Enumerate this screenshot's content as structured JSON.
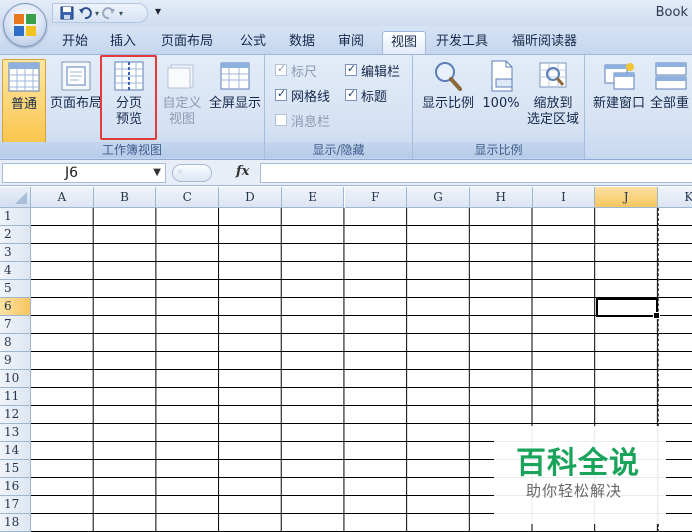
{
  "window": {
    "title": "Book"
  },
  "qat": {
    "more_glyph": "▾"
  },
  "tabs": [
    {
      "label": "开始",
      "active": false
    },
    {
      "label": "插入",
      "active": false
    },
    {
      "label": "页面布局",
      "active": false
    },
    {
      "label": "公式",
      "active": false
    },
    {
      "label": "数据",
      "active": false
    },
    {
      "label": "审阅",
      "active": false
    },
    {
      "label": "视图",
      "active": true
    },
    {
      "label": "开发工具",
      "active": false
    },
    {
      "label": "福昕阅读器",
      "active": false
    }
  ],
  "ribbon": {
    "workbook_views": {
      "group_label": "工作簿视图",
      "normal": "普通",
      "page_layout": "页面布局",
      "page_break_line1": "分页",
      "page_break_line2": "预览",
      "custom_line1": "自定义",
      "custom_line2": "视图",
      "fullscreen": "全屏显示"
    },
    "show_hide": {
      "group_label": "显示/隐藏",
      "ruler": {
        "label": "标尺",
        "checked": true,
        "disabled": true
      },
      "formula_bar": {
        "label": "编辑栏",
        "checked": true,
        "disabled": false
      },
      "gridlines": {
        "label": "网格线",
        "checked": true,
        "disabled": false
      },
      "headings": {
        "label": "标题",
        "checked": true,
        "disabled": false
      },
      "message_bar": {
        "label": "消息栏",
        "checked": false,
        "disabled": true
      }
    },
    "zoom": {
      "group_label": "显示比例",
      "zoom": "显示比例",
      "zoom100": "100%",
      "zoom_sel_line1": "缩放到",
      "zoom_sel_line2": "选定区域"
    },
    "window": {
      "new_window": "新建窗口",
      "arrange_all": "全部重"
    }
  },
  "formula_bar": {
    "name_box": "J6",
    "fx": "fx",
    "formula": ""
  },
  "grid": {
    "columns": [
      "A",
      "B",
      "C",
      "D",
      "E",
      "F",
      "G",
      "H",
      "I",
      "J",
      "K"
    ],
    "rows": [
      "1",
      "2",
      "3",
      "4",
      "5",
      "6",
      "7",
      "8",
      "9",
      "10",
      "11",
      "12",
      "13",
      "14",
      "15",
      "16",
      "17",
      "18"
    ],
    "active_cell": "J6",
    "active_col": "J",
    "active_row": "6"
  },
  "watermark": {
    "title": "百科全说",
    "subtitle": "助你轻松解决"
  },
  "colors": {
    "accent": "#f8c560",
    "highlight": "#e53a3a",
    "watermark": "#1aa35a"
  }
}
